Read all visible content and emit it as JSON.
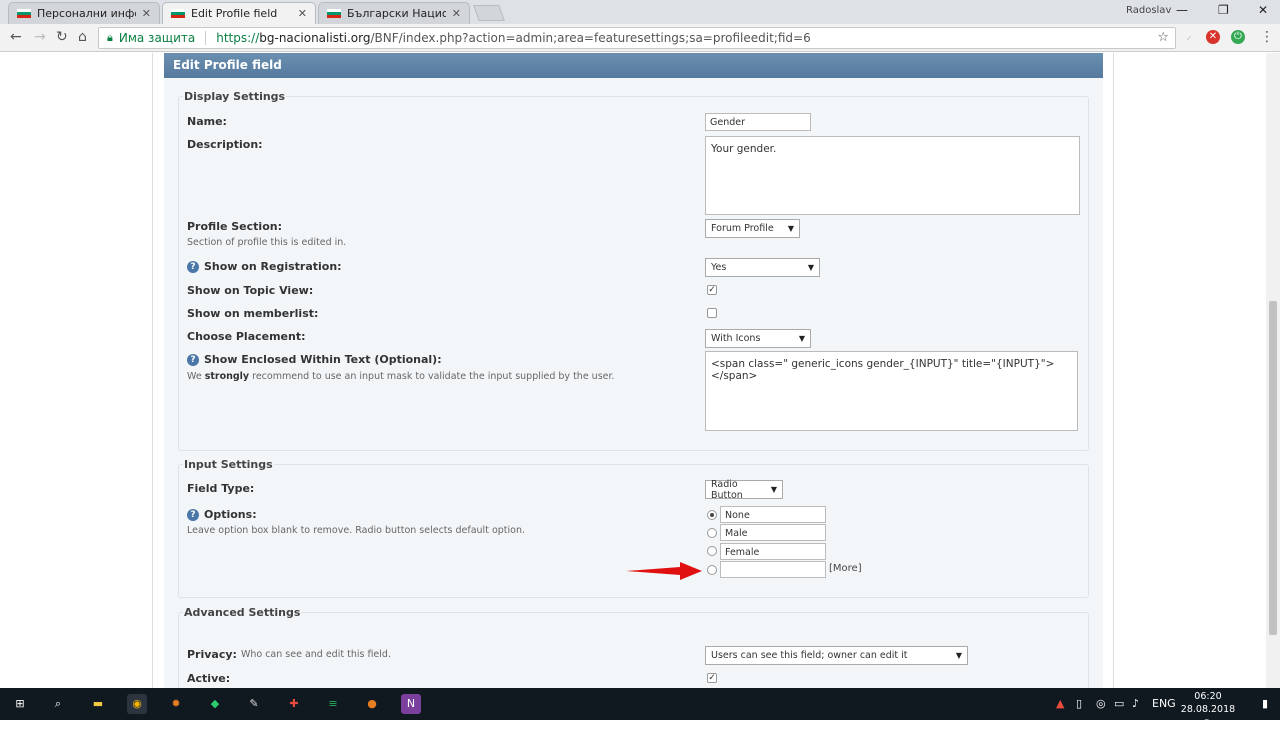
{
  "browser": {
    "tabs": [
      {
        "label": "Персонални информац",
        "active": false
      },
      {
        "label": "Edit Profile field",
        "active": true
      },
      {
        "label": "Български Националист",
        "active": false
      }
    ],
    "user": "Radoslav",
    "secure_label": "Има защита",
    "url_prefix": "https://",
    "url_host": "bg-nacionalisti.org",
    "url_path": "/BNF/index.php?action=admin;area=featuresettings;sa=profileedit;fid=6"
  },
  "page": {
    "title": "Edit Profile field",
    "display_settings": {
      "legend": "Display Settings",
      "name_label": "Name:",
      "name_value": "Gender",
      "description_label": "Description:",
      "description_value": "Your gender.",
      "profile_section_label": "Profile Section:",
      "profile_section_sub": "Section of profile this is edited in.",
      "profile_section_value": "Forum Profile",
      "show_registration_label": "Show on Registration:",
      "show_registration_value": "Yes",
      "show_topic_label": "Show on Topic View:",
      "show_topic_checked": true,
      "show_memberlist_label": "Show on memberlist:",
      "show_memberlist_checked": false,
      "placement_label": "Choose Placement:",
      "placement_value": "With Icons",
      "enclosed_label": "Show Enclosed Within Text (Optional):",
      "enclosed_sub_pre": "We ",
      "enclosed_sub_strong": "strongly",
      "enclosed_sub_post": " recommend to use an input mask to validate the input supplied by the user.",
      "enclosed_value": "<span class=\" generic_icons gender_{INPUT}\" title=\"{INPUT}\"></span>"
    },
    "input_settings": {
      "legend": "Input Settings",
      "field_type_label": "Field Type:",
      "field_type_value": "Radio Button",
      "options_label": "Options:",
      "options_sub": "Leave option box blank to remove. Radio button selects default option.",
      "options": [
        "None",
        "Male",
        "Female",
        ""
      ],
      "more_label": "[More]"
    },
    "advanced_settings": {
      "legend": "Advanced Settings",
      "privacy_label": "Privacy:",
      "privacy_sub": "Who can see and edit this field.",
      "privacy_value": "Users can see this field; owner can edit it",
      "active_label": "Active:",
      "active_checked": true
    }
  },
  "taskbar": {
    "lang": "ENG",
    "time": "06:20",
    "date": "28.08.2018 г."
  },
  "colors": {
    "header_bar": "#557a9e",
    "panel_bg": "#f3f6f9",
    "annotation_arrow": "#e01010"
  }
}
